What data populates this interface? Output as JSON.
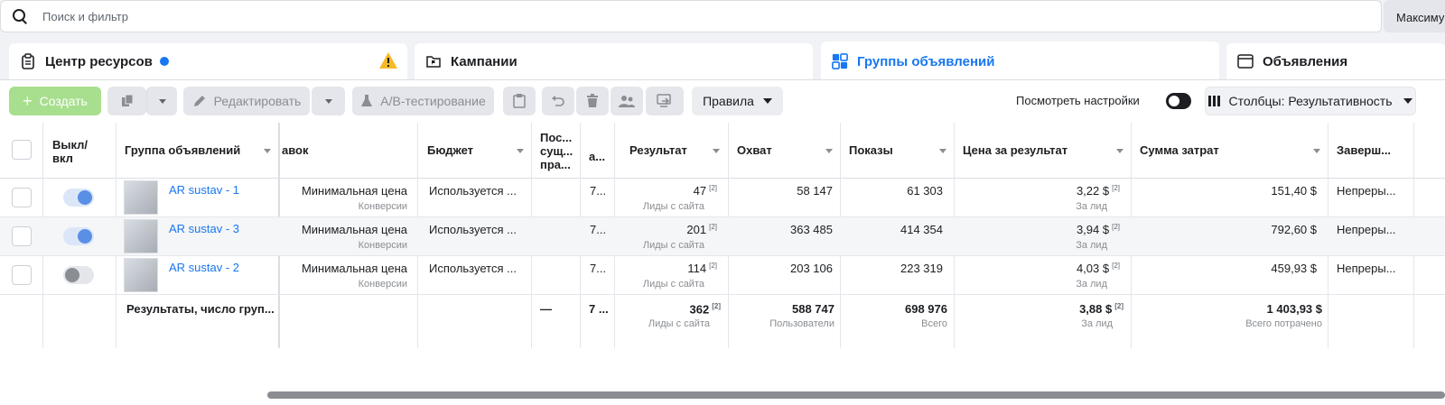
{
  "search": {
    "placeholder": "Поиск и фильтр"
  },
  "account": {
    "label": "Максиму"
  },
  "tabs": [
    {
      "label": "Центр ресурсов"
    },
    {
      "label": "Кампании"
    },
    {
      "label": "Группы объявлений"
    },
    {
      "label": "Объявления"
    }
  ],
  "toolbar": {
    "create": "Создать",
    "edit": "Редактировать",
    "ab_test": "A/B-тестирование",
    "rules": "Правила",
    "view_settings": "Посмотреть настройки",
    "columns": "Столбцы: Результативность"
  },
  "colors": {
    "accent": "#1877f2",
    "create_bg": "#a8df8e",
    "warning": "#f7b928"
  },
  "table": {
    "headers": {
      "onoff": "Выкл/ вкл",
      "adset": "Группа объявлений",
      "bid": "авок",
      "budget": "Бюджет",
      "last_edit": "Пос... сущ... пра...",
      "attr": "а...",
      "result": "Результат",
      "reach": "Охват",
      "impressions": "Показы",
      "cpr": "Цена за результат",
      "spend": "Сумма затрат",
      "ends": "Заверш..."
    },
    "rows": [
      {
        "name": "AR sustav - 1",
        "enabled": true,
        "bid": "Минимальная цена",
        "bid_sub": "Конверсии",
        "budget": "Используется ...",
        "attr": "7...",
        "result": "47",
        "result_sup": "[2]",
        "result_sub": "Лиды с сайта",
        "reach": "58 147",
        "impressions": "61 303",
        "cpr": "3,22 $",
        "cpr_sup": "[2]",
        "cpr_sub": "За лид",
        "spend": "151,40 $",
        "ends": "Непреры..."
      },
      {
        "name": "AR sustav - 3",
        "enabled": true,
        "bid": "Минимальная цена",
        "bid_sub": "Конверсии",
        "budget": "Используется ...",
        "attr": "7...",
        "result": "201",
        "result_sup": "[2]",
        "result_sub": "Лиды с сайта",
        "reach": "363 485",
        "impressions": "414 354",
        "cpr": "3,94 $",
        "cpr_sup": "[2]",
        "cpr_sub": "За лид",
        "spend": "792,60 $",
        "ends": "Непреры..."
      },
      {
        "name": "AR sustav - 2",
        "enabled": false,
        "bid": "Минимальная цена",
        "bid_sub": "Конверсии",
        "budget": "Используется ...",
        "attr": "7...",
        "result": "114",
        "result_sup": "[2]",
        "result_sub": "Лиды с сайта",
        "reach": "203 106",
        "impressions": "223 319",
        "cpr": "4,03 $",
        "cpr_sup": "[2]",
        "cpr_sub": "За лид",
        "spend": "459,93 $",
        "ends": "Непреры..."
      }
    ],
    "totals": {
      "label": "Результаты, число груп...",
      "last_edit": "—",
      "attr": "7 ...",
      "result": "362",
      "result_sup": "[2]",
      "result_sub": "Лиды с сайта",
      "reach": "588 747",
      "reach_sub": "Пользователи",
      "impressions": "698 976",
      "impressions_sub": "Всего",
      "cpr": "3,88 $",
      "cpr_sup": "[2]",
      "cpr_sub": "За лид",
      "spend": "1 403,93 $",
      "spend_sub": "Всего потрачено"
    }
  }
}
